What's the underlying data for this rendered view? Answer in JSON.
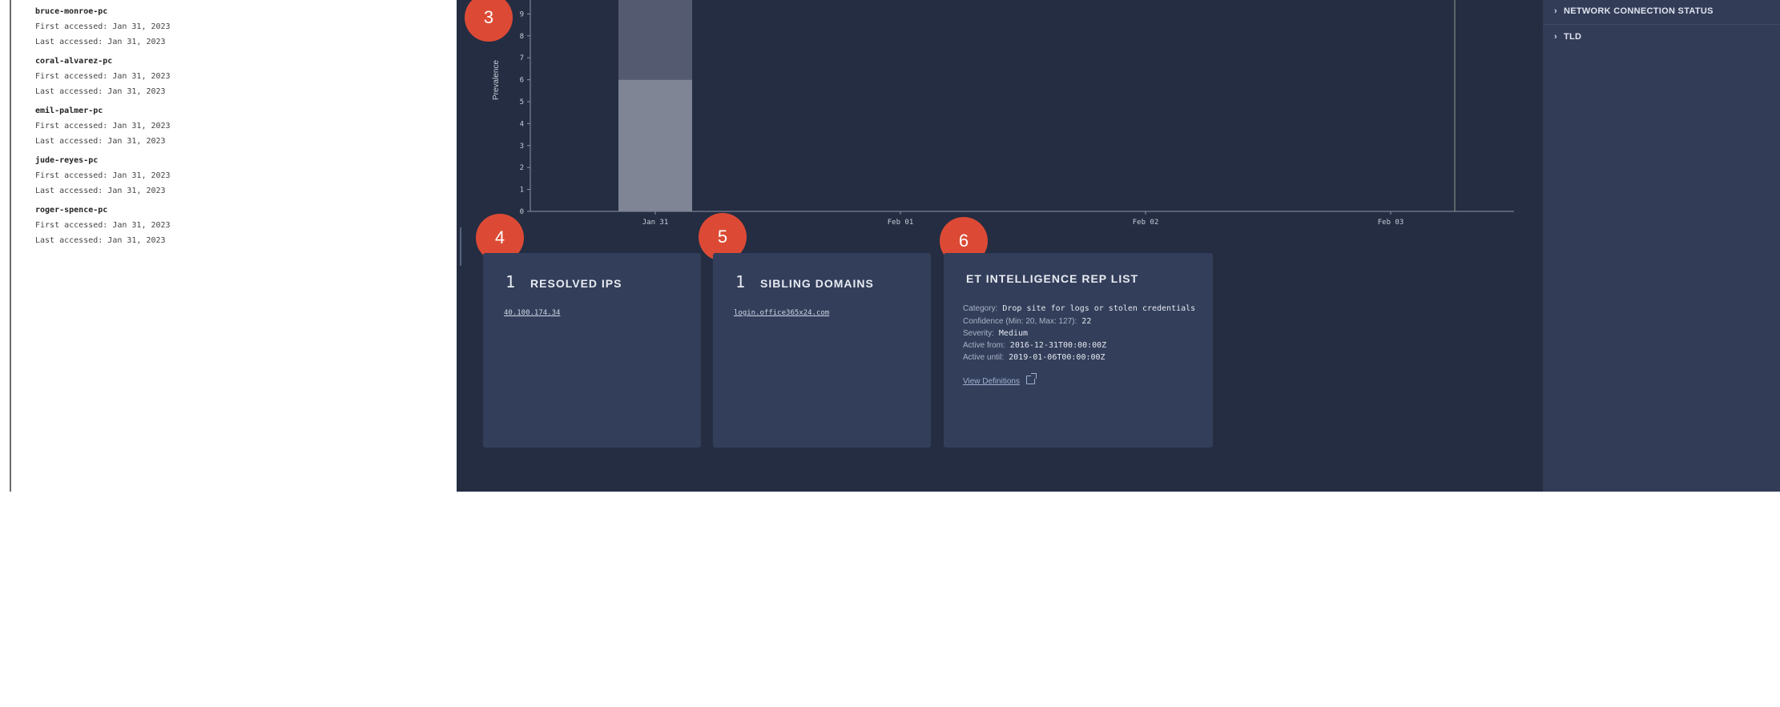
{
  "hosts": [
    {
      "name": "bruce-monroe-pc",
      "first": "First accessed: Jan 31, 2023",
      "last": "Last accessed: Jan 31, 2023"
    },
    {
      "name": "coral-alvarez-pc",
      "first": "First accessed: Jan 31, 2023",
      "last": "Last accessed: Jan 31, 2023"
    },
    {
      "name": "emil-palmer-pc",
      "first": "First accessed: Jan 31, 2023",
      "last": "Last accessed: Jan 31, 2023"
    },
    {
      "name": "jude-reyes-pc",
      "first": "First accessed: Jan 31, 2023",
      "last": "Last accessed: Jan 31, 2023"
    },
    {
      "name": "roger-spence-pc",
      "first": "First accessed: Jan 31, 2023",
      "last": "Last accessed: Jan 31, 2023"
    }
  ],
  "right_panel": {
    "items": [
      {
        "label": "NETWORK CONNECTION STATUS",
        "icon": "chevron-right-icon"
      },
      {
        "label": "TLD",
        "icon": "chevron-right-icon"
      }
    ]
  },
  "badges": [
    "3",
    "4",
    "5",
    "6"
  ],
  "chart_data": {
    "type": "bar",
    "ylabel": "Prevalence",
    "yticks": [
      "0",
      "1",
      "2",
      "3",
      "4",
      "5",
      "6",
      "7",
      "8",
      "9"
    ],
    "xticks": [
      "Jan 31",
      "Feb 01",
      "Feb 02",
      "Feb 03"
    ],
    "series": [
      {
        "values": [
          6,
          0,
          0,
          0
        ]
      },
      {
        "values": [
          4,
          0,
          0,
          0
        ]
      }
    ],
    "ylim": [
      0,
      10
    ],
    "colors": [
      "#7f8595",
      "#545b70"
    ]
  },
  "cards": {
    "resolved_ips": {
      "count": "1",
      "title": "RESOLVED IPS",
      "items": [
        "40.100.174.34"
      ]
    },
    "sibling_domains": {
      "count": "1",
      "title": "SIBLING DOMAINS",
      "items": [
        "login.office365x24.com"
      ]
    },
    "et_rep": {
      "title": "ET INTELLIGENCE REP LIST",
      "rows": [
        {
          "label": "Category:",
          "value": "Drop site for logs or stolen credentials"
        },
        {
          "label": "Confidence (Min: 20, Max: 127):",
          "value": "22"
        },
        {
          "label": "Severity:",
          "value": "Medium"
        },
        {
          "label": "Active from:",
          "value": "2016-12-31T00:00:00Z"
        },
        {
          "label": "Active until:",
          "value": "2019-01-06T00:00:00Z"
        }
      ],
      "link": "View Definitions"
    }
  }
}
